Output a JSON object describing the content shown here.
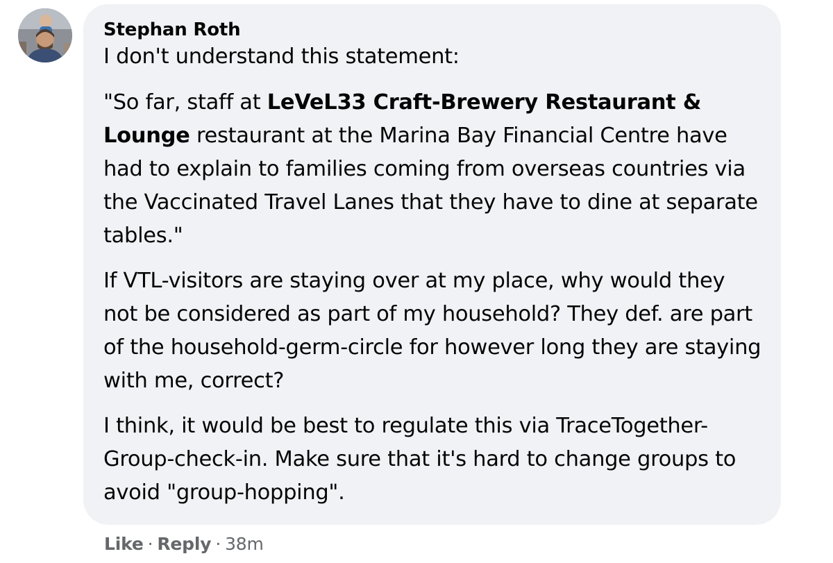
{
  "comment": {
    "author": "Stephan Roth",
    "avatar_icon": "profile-photo-icon",
    "paragraphs": {
      "p1": "I don't understand this statement:",
      "p2_open_quote": "\"So far, staff at ",
      "p2_bold": "LeVeL33 Craft-Brewery Restaurant & Lounge",
      "p2_rest": " restaurant at the Marina Bay Financial Centre have had to explain to families coming from overseas countries via the Vaccinated Travel Lanes that they have to dine at separate tables.\"",
      "p3": "If VTL-visitors are staying over at my place, why would they not be considered as part of my household? They def. are part of the household-germ-circle for however long they are staying with me, correct?",
      "p4": "I think, it would be best to regulate this via TraceTogether-Group-check-in. Make sure that it's hard to change groups to avoid \"group-hopping\"."
    }
  },
  "actions": {
    "like_label": "Like",
    "separator": "·",
    "reply_label": "Reply",
    "timestamp": "38m"
  },
  "colors": {
    "bubble_bg": "#f0f2f5",
    "text": "#050505",
    "meta_text": "#65676b"
  }
}
